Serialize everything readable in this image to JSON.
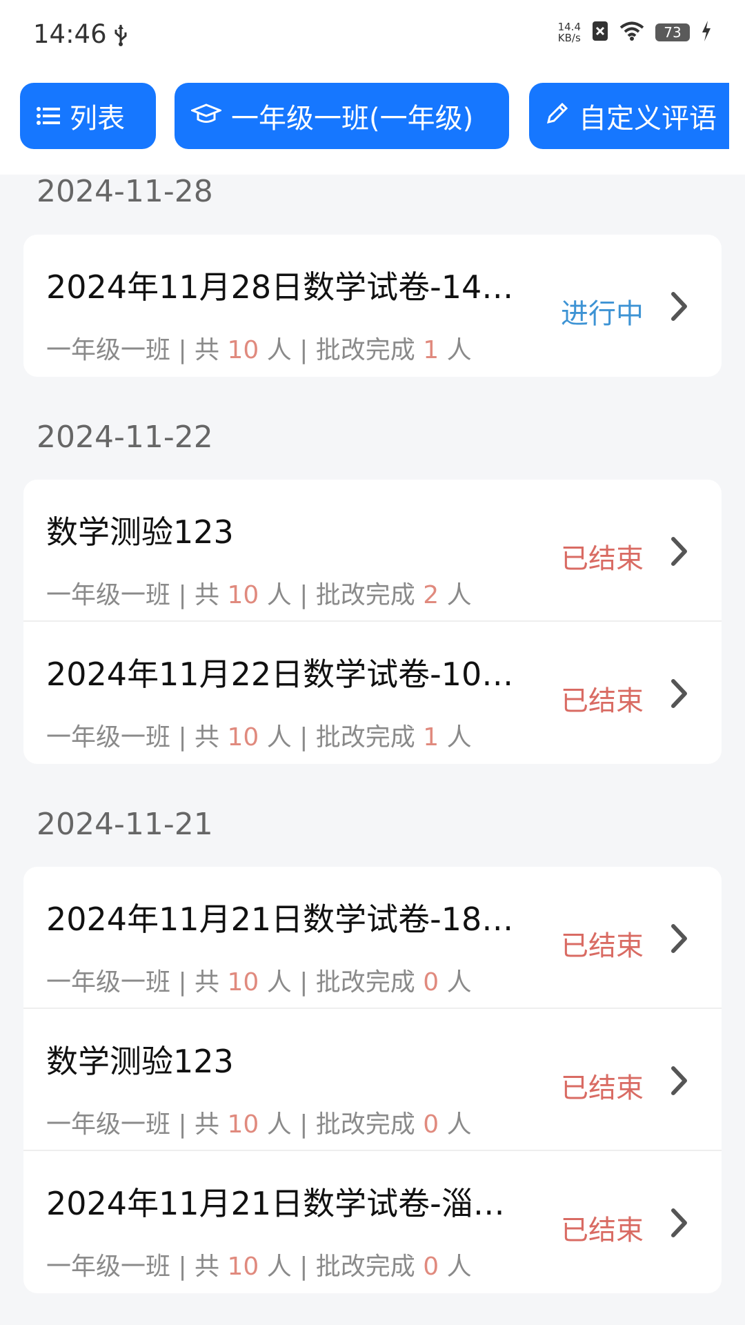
{
  "status_bar": {
    "time": "14:46",
    "speed_value": "14.4",
    "speed_unit": "KB/s",
    "battery": "73"
  },
  "toolbar": {
    "list_label": "列表",
    "class_label": "一年级一班(一年级)",
    "custom_comment_label": "自定义评语",
    "accent_color": "#1677ff"
  },
  "groups": [
    {
      "date": "2024-11-28",
      "items": [
        {
          "title": "2024年11月28日数学试卷-14…",
          "class": "一年级一班",
          "total": "10",
          "done": "1",
          "status": "进行中",
          "status_type": "ongoing"
        }
      ]
    },
    {
      "date": "2024-11-22",
      "items": [
        {
          "title": "数学测验123",
          "class": "一年级一班",
          "total": "10",
          "done": "2",
          "status": "已结束",
          "status_type": "ended"
        },
        {
          "title": "2024年11月22日数学试卷-10…",
          "class": "一年级一班",
          "total": "10",
          "done": "1",
          "status": "已结束",
          "status_type": "ended"
        }
      ]
    },
    {
      "date": "2024-11-21",
      "items": [
        {
          "title": "2024年11月21日数学试卷-18…",
          "class": "一年级一班",
          "total": "10",
          "done": "0",
          "status": "已结束",
          "status_type": "ended"
        },
        {
          "title": "数学测验123",
          "class": "一年级一班",
          "total": "10",
          "done": "0",
          "status": "已结束",
          "status_type": "ended"
        },
        {
          "title": "2024年11月21日数学试卷-淄…",
          "class": "一年级一班",
          "total": "10",
          "done": "0",
          "status": "已结束",
          "status_type": "ended"
        }
      ]
    }
  ],
  "labels": {
    "sep": " | ",
    "total_prefix": "共 ",
    "person_suffix": " 人",
    "done_prefix": "批改完成 "
  }
}
